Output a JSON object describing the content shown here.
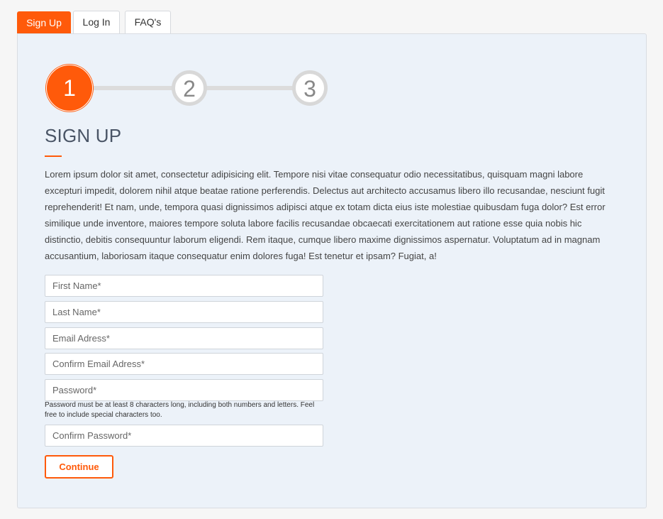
{
  "tabs": [
    {
      "label": "Sign Up",
      "active": true
    },
    {
      "label": "Log In",
      "active": false
    },
    {
      "label": "FAQ's",
      "active": false
    }
  ],
  "steps": {
    "current": 1,
    "items": [
      "1",
      "2",
      "3"
    ]
  },
  "signup": {
    "title": "SIGN UP",
    "intro": "Lorem ipsum dolor sit amet, consectetur adipisicing elit. Tempore nisi vitae consequatur odio necessitatibus, quisquam magni labore excepturi impedit, dolorem nihil atque beatae ratione perferendis. Delectus aut architecto accusamus libero illo recusandae, nesciunt fugit reprehenderit! Et nam, unde, tempora quasi dignissimos adipisci atque ex totam dicta eius iste molestiae quibusdam fuga dolor? Est error similique unde inventore, maiores tempore soluta labore facilis recusandae obcaecati exercitationem aut ratione esse quia nobis hic distinctio, debitis consequuntur laborum eligendi. Rem itaque, cumque libero maxime dignissimos aspernatur. Voluptatum ad in magnam accusantium, laboriosam itaque consequatur enim dolores fuga! Est tenetur et ipsam? Fugiat, a!",
    "fields": {
      "first_name": {
        "value": "",
        "placeholder": "First Name*"
      },
      "last_name": {
        "value": "",
        "placeholder": "Last Name*"
      },
      "email": {
        "value": "",
        "placeholder": "Email Adress*"
      },
      "confirm_email": {
        "value": "",
        "placeholder": "Confirm Email Adress*"
      },
      "password": {
        "value": "",
        "placeholder": "Password*"
      },
      "confirm_password": {
        "value": "",
        "placeholder": "Confirm Password*"
      }
    },
    "password_help": "Password must be at least 8 characters long, including both numbers and letters. Feel free to include special characters too.",
    "continue_label": "Continue"
  },
  "colors": {
    "accent": "#ff5a0a",
    "panel_bg": "#ecf2f9",
    "page_bg": "#f6f6f6"
  }
}
